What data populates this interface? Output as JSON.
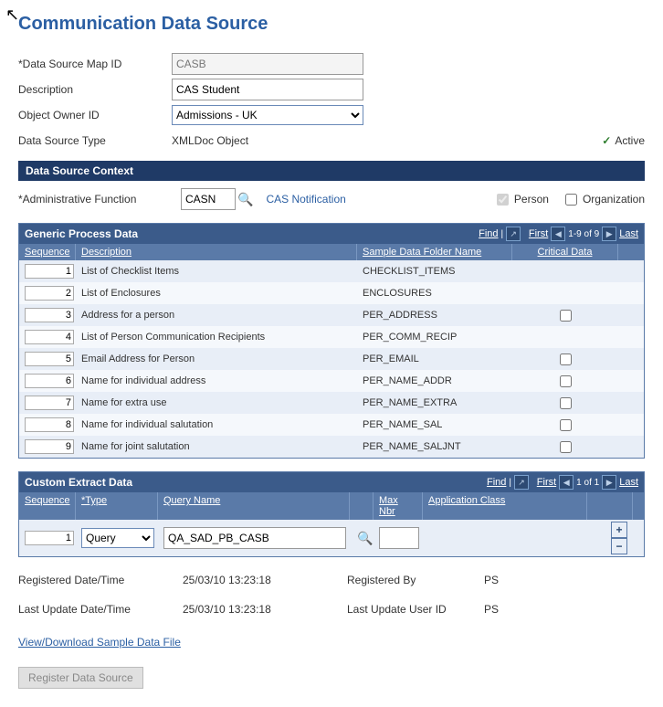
{
  "page_title": "Communication Data Source",
  "form": {
    "map_id_label": "Data Source Map ID",
    "map_id_value": "CASB",
    "desc_label": "Description",
    "desc_value": "CAS Student",
    "owner_label": "Object Owner ID",
    "owner_value": "Admissions - UK",
    "src_type_label": "Data Source Type",
    "src_type_value": "XMLDoc Object",
    "active_label": "Active",
    "active_checked": true
  },
  "context": {
    "bar_label": "Data Source Context",
    "admin_label": "Administrative Function",
    "admin_value": "CASN",
    "admin_desc": "CAS Notification",
    "person_label": "Person",
    "person_checked": true,
    "org_label": "Organization",
    "org_checked": false
  },
  "gpd": {
    "title": "Generic Process Data",
    "find": "Find",
    "nav_first": "First",
    "nav_range": "1-9 of 9",
    "nav_last": "Last",
    "headers": {
      "seq": "Sequence",
      "desc": "Description",
      "folder": "Sample Data Folder Name",
      "crit": "Critical Data"
    },
    "rows": [
      {
        "seq": "1",
        "desc": "List of Checklist Items",
        "folder": "CHECKLIST_ITEMS",
        "crit": null
      },
      {
        "seq": "2",
        "desc": "List of Enclosures",
        "folder": "ENCLOSURES",
        "crit": null
      },
      {
        "seq": "3",
        "desc": "Address for a person",
        "folder": "PER_ADDRESS",
        "crit": false
      },
      {
        "seq": "4",
        "desc": "List of Person Communication Recipients",
        "folder": "PER_COMM_RECIP",
        "crit": null
      },
      {
        "seq": "5",
        "desc": "Email Address for Person",
        "folder": "PER_EMAIL",
        "crit": false
      },
      {
        "seq": "6",
        "desc": "Name for individual address",
        "folder": "PER_NAME_ADDR",
        "crit": false
      },
      {
        "seq": "7",
        "desc": "Name for extra use",
        "folder": "PER_NAME_EXTRA",
        "crit": false
      },
      {
        "seq": "8",
        "desc": "Name for individual salutation",
        "folder": "PER_NAME_SAL",
        "crit": false
      },
      {
        "seq": "9",
        "desc": "Name for joint salutation",
        "folder": "PER_NAME_SALJNT",
        "crit": false
      }
    ]
  },
  "ced": {
    "title": "Custom Extract Data",
    "find": "Find",
    "nav_first": "First",
    "nav_range": "1 of 1",
    "nav_last": "Last",
    "headers": {
      "seq": "Sequence",
      "type": "*Type",
      "qname": "Query Name",
      "max": "Max Nbr",
      "app": "Application Class"
    },
    "rows": [
      {
        "seq": "1",
        "type": "Query",
        "qname": "QA_SAD_PB_CASB",
        "max": "",
        "app": ""
      }
    ]
  },
  "meta": {
    "reg_dt_label": "Registered Date/Time",
    "reg_dt_value": "25/03/10 13:23:18",
    "reg_by_label": "Registered By",
    "reg_by_value": "PS",
    "upd_dt_label": "Last Update Date/Time",
    "upd_dt_value": "25/03/10 13:23:18",
    "upd_by_label": "Last Update User ID",
    "upd_by_value": "PS"
  },
  "download_link": "View/Download Sample Data File",
  "register_btn": "Register Data Source"
}
